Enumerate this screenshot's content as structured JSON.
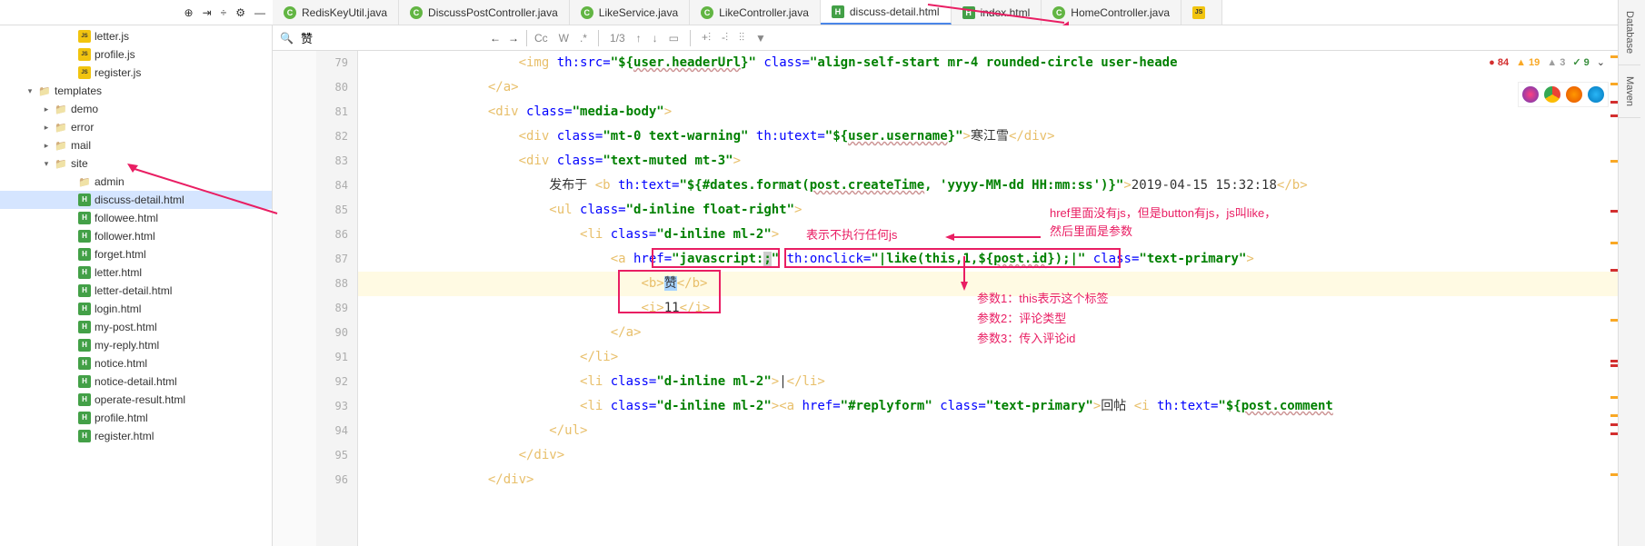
{
  "tabs": [
    {
      "icon": "C",
      "iconClass": "icon-c",
      "label": "RedisKeyUtil.java",
      "active": false
    },
    {
      "icon": "C",
      "iconClass": "icon-c",
      "label": "DiscussPostController.java",
      "active": false
    },
    {
      "icon": "C",
      "iconClass": "icon-c",
      "label": "LikeService.java",
      "active": false
    },
    {
      "icon": "C",
      "iconClass": "icon-c",
      "label": "LikeController.java",
      "active": false
    },
    {
      "icon": "H",
      "iconClass": "icon-h",
      "label": "discuss-detail.html",
      "active": true
    },
    {
      "icon": "H",
      "iconClass": "icon-h",
      "label": "index.html",
      "active": false
    },
    {
      "icon": "C",
      "iconClass": "icon-c",
      "label": "HomeController.java",
      "active": false
    },
    {
      "icon": "JS",
      "iconClass": "icon-js",
      "label": "",
      "active": false
    }
  ],
  "tree": [
    {
      "indent": 60,
      "arrow": "",
      "iconClass": "file-icon-js",
      "icon": "JS",
      "label": "letter.js",
      "selected": false
    },
    {
      "indent": 60,
      "arrow": "",
      "iconClass": "file-icon-js",
      "icon": "JS",
      "label": "profile.js",
      "selected": false
    },
    {
      "indent": 60,
      "arrow": "",
      "iconClass": "file-icon-js",
      "icon": "JS",
      "label": "register.js",
      "selected": false
    },
    {
      "indent": 16,
      "arrow": "▾",
      "iconClass": "folder-icon",
      "icon": "",
      "label": "templates",
      "selected": false
    },
    {
      "indent": 34,
      "arrow": "▸",
      "iconClass": "folder-icon",
      "icon": "",
      "label": "demo",
      "selected": false
    },
    {
      "indent": 34,
      "arrow": "▸",
      "iconClass": "folder-icon",
      "icon": "",
      "label": "error",
      "selected": false
    },
    {
      "indent": 34,
      "arrow": "▸",
      "iconClass": "folder-icon",
      "icon": "",
      "label": "mail",
      "selected": false
    },
    {
      "indent": 34,
      "arrow": "▾",
      "iconClass": "folder-icon",
      "icon": "",
      "label": "site",
      "selected": false
    },
    {
      "indent": 60,
      "arrow": "",
      "iconClass": "folder-icon",
      "icon": "",
      "label": "admin",
      "selected": false
    },
    {
      "indent": 60,
      "arrow": "",
      "iconClass": "file-icon-h",
      "icon": "H",
      "label": "discuss-detail.html",
      "selected": true
    },
    {
      "indent": 60,
      "arrow": "",
      "iconClass": "file-icon-h",
      "icon": "H",
      "label": "followee.html",
      "selected": false
    },
    {
      "indent": 60,
      "arrow": "",
      "iconClass": "file-icon-h",
      "icon": "H",
      "label": "follower.html",
      "selected": false
    },
    {
      "indent": 60,
      "arrow": "",
      "iconClass": "file-icon-h",
      "icon": "H",
      "label": "forget.html",
      "selected": false
    },
    {
      "indent": 60,
      "arrow": "",
      "iconClass": "file-icon-h",
      "icon": "H",
      "label": "letter.html",
      "selected": false
    },
    {
      "indent": 60,
      "arrow": "",
      "iconClass": "file-icon-h",
      "icon": "H",
      "label": "letter-detail.html",
      "selected": false
    },
    {
      "indent": 60,
      "arrow": "",
      "iconClass": "file-icon-h",
      "icon": "H",
      "label": "login.html",
      "selected": false
    },
    {
      "indent": 60,
      "arrow": "",
      "iconClass": "file-icon-h",
      "icon": "H",
      "label": "my-post.html",
      "selected": false
    },
    {
      "indent": 60,
      "arrow": "",
      "iconClass": "file-icon-h",
      "icon": "H",
      "label": "my-reply.html",
      "selected": false
    },
    {
      "indent": 60,
      "arrow": "",
      "iconClass": "file-icon-h",
      "icon": "H",
      "label": "notice.html",
      "selected": false
    },
    {
      "indent": 60,
      "arrow": "",
      "iconClass": "file-icon-h",
      "icon": "H",
      "label": "notice-detail.html",
      "selected": false
    },
    {
      "indent": 60,
      "arrow": "",
      "iconClass": "file-icon-h",
      "icon": "H",
      "label": "operate-result.html",
      "selected": false
    },
    {
      "indent": 60,
      "arrow": "",
      "iconClass": "file-icon-h",
      "icon": "H",
      "label": "profile.html",
      "selected": false
    },
    {
      "indent": 60,
      "arrow": "",
      "iconClass": "file-icon-h",
      "icon": "H",
      "label": "register.html",
      "selected": false
    }
  ],
  "search": {
    "value": "赞",
    "count": "1/3",
    "cc": "Cc",
    "w": "W",
    "star": ".*"
  },
  "inspection": {
    "err": "84",
    "warn": "19",
    "weak": "3",
    "ok": "9"
  },
  "gutter": [
    "79",
    "80",
    "81",
    "82",
    "83",
    "84",
    "85",
    "86",
    "87",
    "88",
    "89",
    "90",
    "91",
    "92",
    "93",
    "94",
    "95",
    "96"
  ],
  "code": {
    "l79": {
      "pre": "                    <",
      "tag": "img",
      "a1": " th:src=",
      "s1": "\"${",
      "w1": "user.headerUrl",
      "s1b": "}\"",
      "a2": " class=",
      "s2": "\"align-self-start mr-4 rounded-circle user-heade"
    },
    "l80": "                </a>",
    "l81": {
      "pre": "                <",
      "tag": "div",
      "a1": " class=",
      "s1": "\"media-body\"",
      "post": ">"
    },
    "l82": {
      "pre": "                    <",
      "tag": "div",
      "a1": " class=",
      "s1": "\"mt-0 text-warning\"",
      "a2": " th:utext=",
      "s2": "\"${",
      "w2": "user.username",
      "s2b": "}\"",
      "post": ">寒江雪</div>"
    },
    "l83": {
      "pre": "                    <",
      "tag": "div",
      "a1": " class=",
      "s1": "\"text-muted mt-3\"",
      "post": ">"
    },
    "l84": {
      "pre": "                        发布于 <",
      "tag": "b",
      "a1": " th:text=",
      "s1": "\"${#dates.format(",
      "w1": "post.createTime",
      "s1b": ", 'yyyy-MM-dd HH:mm:ss')}\"",
      "post": ">2019-04-15 15:32:18</b>"
    },
    "l85": {
      "pre": "                        <",
      "tag": "ul",
      "a1": " class=",
      "s1": "\"d-inline float-right\"",
      "post": ">"
    },
    "l86": {
      "pre": "                            <",
      "tag": "li",
      "a1": " class=",
      "s1": "\"d-inline ml-2\"",
      "post": ">"
    },
    "l87": {
      "pre": "                                <",
      "tag": "a",
      "a1": " href=",
      "s1": "\"javascript:;\"",
      "a2": " th:onclick=",
      "s2": "\"|like(this,1,${",
      "w2": "post.id",
      "s2b": "});|\"",
      "a3": " class=",
      "s3": "\"text-primary\"",
      "post": ">"
    },
    "l88": {
      "pre": "                                    <",
      "tag": "b",
      "post": ">",
      "txt": "赞",
      "close": "</b>"
    },
    "l89": {
      "pre": "                                    <",
      "tag": "i",
      "post": ">11</i>"
    },
    "l90": "                                </a>",
    "l91": "                            </li>",
    "l92": {
      "pre": "                            <",
      "tag": "li",
      "a1": " class=",
      "s1": "\"d-inline ml-2\"",
      "post": ">|</li>"
    },
    "l93": {
      "pre": "                            <",
      "tag": "li",
      "a1": " class=",
      "s1": "\"d-inline ml-2\"",
      "post": "><",
      "tag2": "a",
      "a2": " href=",
      "s2": "\"#replyform\"",
      "a3": " class=",
      "s3": "\"text-primary\"",
      "post2": ">回帖 <",
      "tag3": "i",
      "a4": " th:text=",
      "s4": "\"${",
      "w4": "post.comment"
    },
    "l94": "                        </ul>",
    "l95": "                    </div>",
    "l96": "                </div>"
  },
  "annotations": {
    "note1": "表示不执行任何js",
    "note2a": "href里面没有js，但是button有js，js叫like，",
    "note2b": "然后里面是参数",
    "note3a": "参数1：this表示这个标签",
    "note3b": "参数2：评论类型",
    "note3c": "参数3：传入评论id"
  },
  "right": {
    "tab1": "Database",
    "tab2": "Maven"
  }
}
